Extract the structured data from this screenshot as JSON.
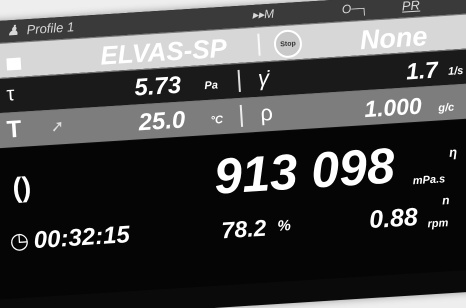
{
  "status_bar": {
    "profile_label": "Profile 1",
    "mode_indicator": "▸▸M",
    "key_indicator": "O─┐",
    "pr_label": "PR"
  },
  "rows": {
    "measuring_system": {
      "symbol": "▄",
      "value": "ELVAS-SP",
      "stop_label": "Stop",
      "right_value": "None"
    },
    "shear_stress": {
      "symbol": "τ",
      "value": "5.73",
      "unit": "Pa",
      "right_symbol": "γ̇",
      "right_value": "1.7",
      "right_unit": "1/s"
    },
    "temperature": {
      "symbol": "T",
      "value": "25.0",
      "unit": "°C",
      "right_symbol": "ρ",
      "right_value": "1.000",
      "right_unit": "g/c"
    }
  },
  "main": {
    "spindle_icon": "()",
    "viscosity_value": "913 098",
    "viscosity_unit": "mPa.s",
    "viscosity_symbol": "η",
    "elapsed_time": "00:32:15",
    "torque_value": "78.2",
    "torque_unit": "%",
    "speed_value": "0.88",
    "speed_unit": "rpm",
    "speed_symbol": "n"
  },
  "colors": {
    "screen_bg": "#0a0a0a",
    "band_light": "#d7d7d7",
    "band_mid": "#7d7d7d",
    "band_dark": "#1a1a1a",
    "text": "#ffffff"
  }
}
